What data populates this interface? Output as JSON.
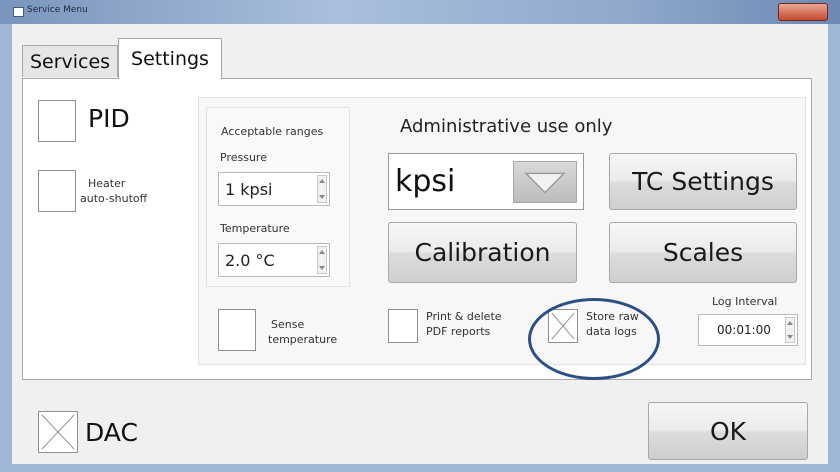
{
  "window": {
    "title": "Service Menu"
  },
  "tabs": [
    {
      "label": "Services",
      "active": false
    },
    {
      "label": "Settings",
      "active": true
    }
  ],
  "settings": {
    "pid": {
      "label": "PID",
      "checked": false
    },
    "heater": {
      "label_line1": "Heater",
      "label_line2": "auto-shutoff",
      "checked": false
    },
    "ranges": {
      "heading": "Acceptable ranges",
      "pressure_label": "Pressure",
      "pressure_value": "1 kpsi",
      "temperature_label": "Temperature",
      "temperature_value": "2.0 °C"
    },
    "sense": {
      "label_line1": "Sense",
      "label_line2": "temperature",
      "checked": false
    },
    "admin": {
      "heading": "Administrative use only",
      "units_value": "kpsi",
      "tc_settings": "TC Settings",
      "calibration": "Calibration",
      "scales": "Scales"
    },
    "print_delete": {
      "label_line1": "Print & delete",
      "label_line2": "PDF reports",
      "checked": false
    },
    "store_raw": {
      "label_line1": "Store raw",
      "label_line2": "data logs",
      "checked": true
    },
    "log_interval": {
      "label": "Log Interval",
      "value": "00:01:00"
    }
  },
  "footer": {
    "dac": {
      "label": "DAC",
      "checked": true
    },
    "ok_label": "OK"
  },
  "colors": {
    "highlight_ellipse": "#2c4f85",
    "titlebar": "#8fa8cc",
    "close_button": "#c44a2e"
  },
  "icons": [
    "app-icon",
    "close-icon",
    "chevron-down-icon",
    "spin-up-icon",
    "spin-down-icon",
    "checkbox-checked-icon"
  ]
}
